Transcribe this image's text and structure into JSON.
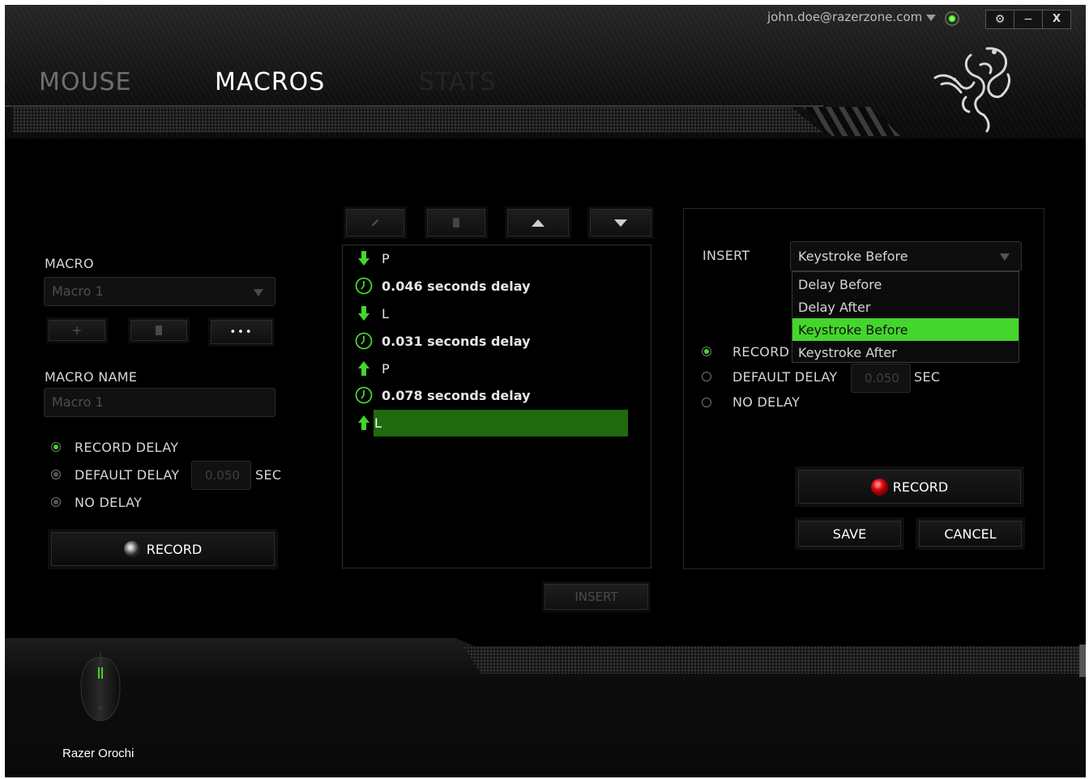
{
  "account": {
    "email": "john.doe@razerzone.com"
  },
  "window_controls": {
    "settings": "⚙",
    "minimize": "−",
    "close": "X"
  },
  "tabs": [
    {
      "label": "MOUSE",
      "state": "inactive"
    },
    {
      "label": "MACROS",
      "state": "active"
    },
    {
      "label": "STATS",
      "state": "faded"
    }
  ],
  "left": {
    "macro_label": "MACRO",
    "macro_select": "Macro 1",
    "macro_buttons": {
      "add": "+",
      "more": "•••"
    },
    "macro_name_label": "MACRO NAME",
    "macro_name_value": "Macro 1",
    "options": [
      {
        "label": "RECORD DELAY",
        "state": "selected"
      },
      {
        "label": "DEFAULT DELAY",
        "state": "unselected"
      },
      {
        "label": "NO DELAY",
        "state": "unselected"
      }
    ],
    "default_delay_value": "0.050",
    "sec_label": "SEC",
    "record_label": "RECORD"
  },
  "macro_list": [
    {
      "type": "key-down",
      "text": "P",
      "selected": false
    },
    {
      "type": "delay",
      "text": "0.046 seconds delay",
      "selected": false
    },
    {
      "type": "key-down",
      "text": "L",
      "selected": false
    },
    {
      "type": "delay",
      "text": "0.031 seconds delay",
      "selected": false
    },
    {
      "type": "key-up",
      "text": "P",
      "selected": false
    },
    {
      "type": "delay",
      "text": "0.078 seconds delay",
      "selected": false
    },
    {
      "type": "key-up",
      "text": "L",
      "selected": true
    }
  ],
  "insert_button": "INSERT",
  "right": {
    "insert_label": "INSERT",
    "insert_select_value": "Keystroke Before",
    "dropdown_options": [
      "Delay Before",
      "Delay After",
      "Keystroke Before",
      "Keystroke After"
    ],
    "dropdown_highlighted": "Keystroke Before",
    "options": [
      {
        "label": "RECORD I",
        "state": "selected"
      },
      {
        "label": "DEFAULT DELAY",
        "state": "unselected"
      },
      {
        "label": "NO DELAY",
        "state": "unselected"
      }
    ],
    "default_delay_value": "0.050",
    "sec_label": "SEC",
    "record_label": "RECORD",
    "save_label": "SAVE",
    "cancel_label": "CANCEL"
  },
  "device": {
    "name": "Razer Orochi"
  },
  "colors": {
    "accent": "#44d62c",
    "highlight": "#1f6a0f",
    "record_red": "#e01010"
  }
}
